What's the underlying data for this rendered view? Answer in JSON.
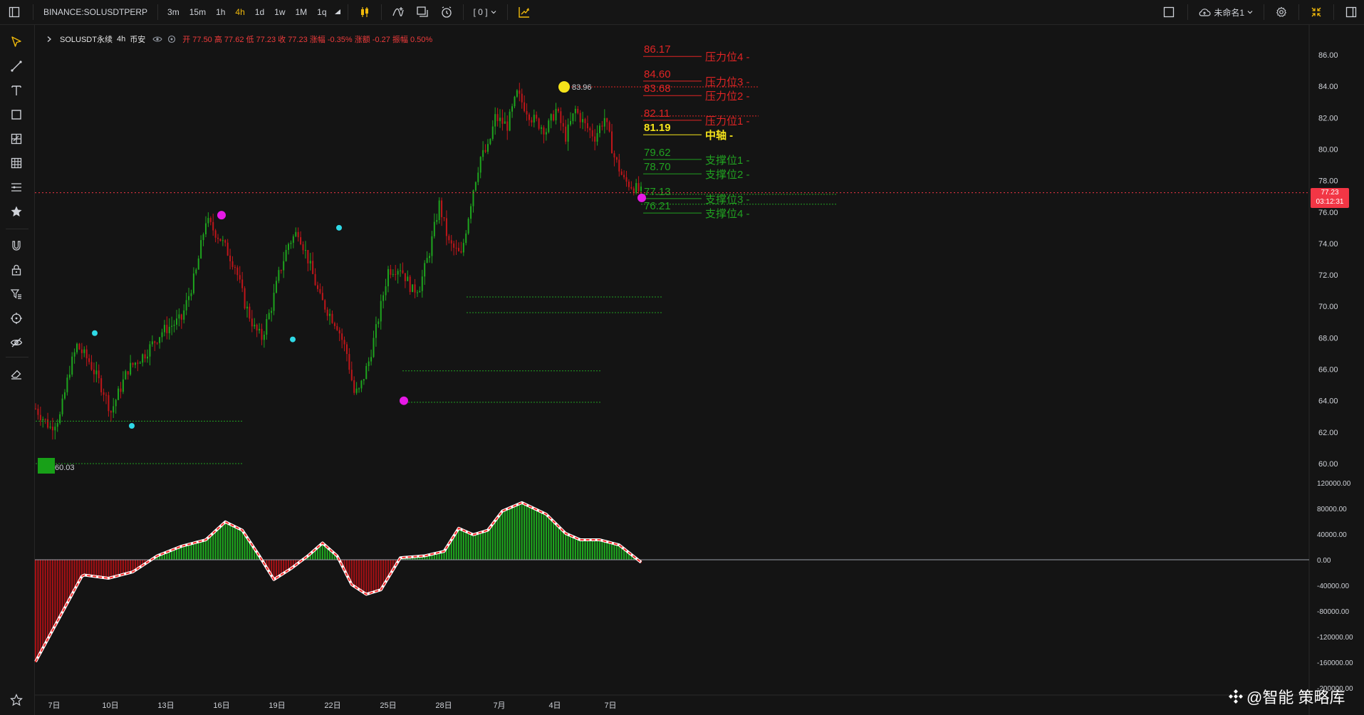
{
  "toolbar": {
    "symbol": "BINANCE:SOLUSDTPERP",
    "intervals": [
      "3m",
      "15m",
      "1h",
      "4h",
      "1d",
      "1w",
      "1M",
      "1q"
    ],
    "active_interval": "4h",
    "indicator_count": "[ 0 ]",
    "layout_name": "未命名1"
  },
  "legend": {
    "title": "SOLUSDT永续",
    "interval": "4h",
    "exchange": "币安",
    "ohlc": "开 77.50  高 77.62  低 77.23  收 77.23  涨幅 -0.35%  涨额 -0.27  振幅 0.50%"
  },
  "colors": {
    "up": "#1ea51e",
    "down": "#c0161a",
    "resistance": "#e02424",
    "support": "#21a121",
    "pivot": "#f5e31a",
    "magenta": "#e619e6",
    "cyan": "#2fd9e6",
    "price_tag": "#f23645"
  },
  "price_axis": {
    "labels": [
      "86.00",
      "84.00",
      "82.00",
      "80.00",
      "78.00",
      "76.00",
      "74.00",
      "72.00",
      "70.00",
      "68.00",
      "66.00",
      "64.00",
      "62.00",
      "60.00"
    ],
    "current_price": "77.23",
    "countdown": "03:12:31"
  },
  "macd_axis": {
    "labels": [
      "120000.00",
      "80000.00",
      "40000.00",
      "0.00",
      "-40000.00",
      "-80000.00",
      "-120000.00",
      "-160000.00",
      "-200000.00"
    ]
  },
  "time_axis": {
    "labels": [
      "7日",
      "10日",
      "13日",
      "16日",
      "19日",
      "22日",
      "25日",
      "28日",
      "7月",
      "4日",
      "7日"
    ]
  },
  "levels": {
    "resistance": [
      {
        "price": "86.17",
        "name": "压力位4 -"
      },
      {
        "price": "84.60",
        "name": "压力位3 -"
      },
      {
        "price": "83.68",
        "name": "压力位2 -"
      },
      {
        "price": "82.11",
        "name": "压力位1 -"
      }
    ],
    "pivot": {
      "price": "81.19",
      "name": "中轴 -"
    },
    "support": [
      {
        "price": "79.62",
        "name": "支撑位1 -"
      },
      {
        "price": "78.70",
        "name": "支撑位2 -"
      },
      {
        "price": "77.13",
        "name": "支撑位3 -"
      },
      {
        "price": "76.21",
        "name": "支撑位4 -"
      }
    ]
  },
  "annotations": {
    "high_label": "83.96",
    "low_label": "60.03"
  },
  "watermark": "@智能 策略库"
}
